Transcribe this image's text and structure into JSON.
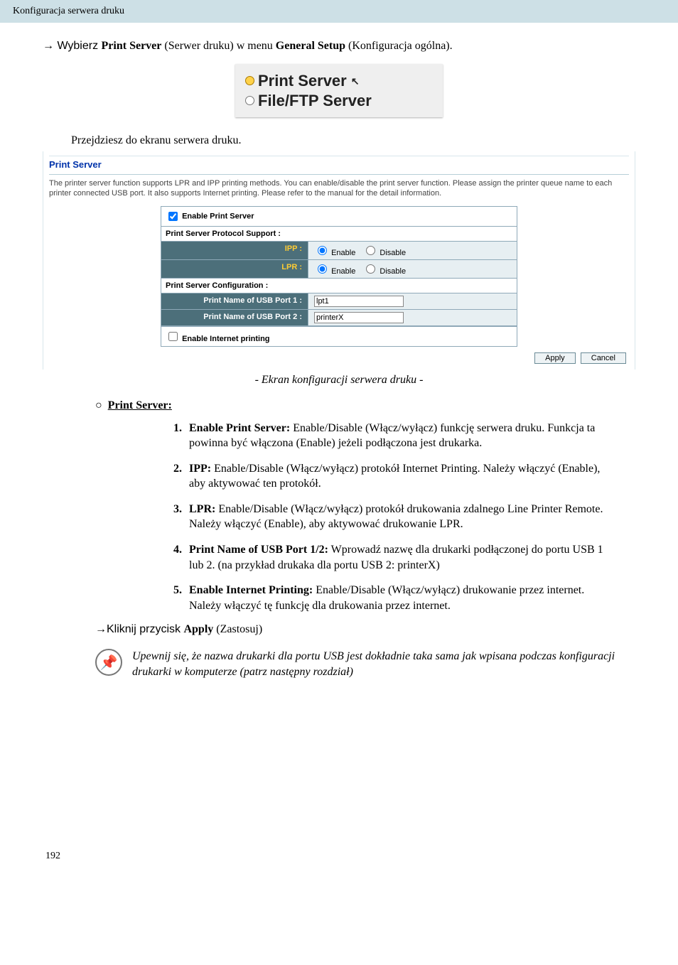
{
  "header": {
    "breadcrumb": "Konfiguracja serwera druku"
  },
  "step1": {
    "prefix": "→  Wybierz ",
    "bold1": "Print Server",
    "mid1": " (Serwer druku) w menu ",
    "bold2": "General Setup",
    "suffix": " (Konfiguracja ogólna)."
  },
  "menu_shot": {
    "opt1": "Print Server",
    "opt2": "File/FTP Server"
  },
  "intro2": "Przejdziesz do ekranu serwera druku.",
  "panel": {
    "title": "Print Server",
    "desc": "The printer server function supports LPR and IPP printing methods. You can enable/disable the print server function. Please assign the printer queue name to each printer connected USB port. It also supports Internet printing. Please refer to the manual for the detail information.",
    "enable_label": "Enable Print Server",
    "sect1": "Print Server Protocol Support :",
    "ipp_label": "IPP :",
    "lpr_label": "LPR :",
    "enable": "Enable",
    "disable": "Disable",
    "sect2": "Print Server Configuration :",
    "usb1_label": "Print Name of USB Port 1 :",
    "usb1_value": "lpt1",
    "usb2_label": "Print Name of USB Port 2 :",
    "usb2_value": "printerX",
    "internet_label": "Enable Internet printing",
    "apply_btn": "Apply",
    "cancel_btn": "Cancel"
  },
  "caption": "- Ekran konfiguracji serwera druku -",
  "subhead": "Print Server:",
  "list": {
    "i1_b": "Enable Print Server:",
    "i1_t": " Enable/Disable (Włącz/wyłącz) funkcję serwera druku. Funkcja ta powinna być włączona (Enable) jeżeli podłączona jest drukarka.",
    "i2_b": "IPP:",
    "i2_t": " Enable/Disable (Włącz/wyłącz) protokół Internet Printing. Należy włączyć (Enable), aby aktywować ten protokół.",
    "i3_b": "LPR:",
    "i3_t": " Enable/Disable (Włącz/wyłącz) protokół drukowania zdalnego Line Printer Remote. Należy włączyć (Enable), aby aktywować drukowanie LPR.",
    "i4_b": "Print Name of USB Port 1/2:",
    "i4_t": " Wprowadź nazwę dla drukarki podłączonej do portu USB 1 lub 2. (na przykład drukaka dla portu USB 2: printerX)",
    "i5_b": "Enable Internet Printing:",
    "i5_t": " Enable/Disable (Włącz/wyłącz) drukowanie przez internet. Należy włączyć tę funkcję dla drukowania przez internet."
  },
  "apply_line": {
    "prefix": "→Kliknij przycisk ",
    "bold": "Apply",
    "suffix": " (Zastosuj)"
  },
  "note": "Upewnij się, że nazwa drukarki dla portu USB jest dokładnie taka sama jak wpisana podczas konfiguracji drukarki w komputerze (patrz następny rozdział)",
  "page_number": "192"
}
